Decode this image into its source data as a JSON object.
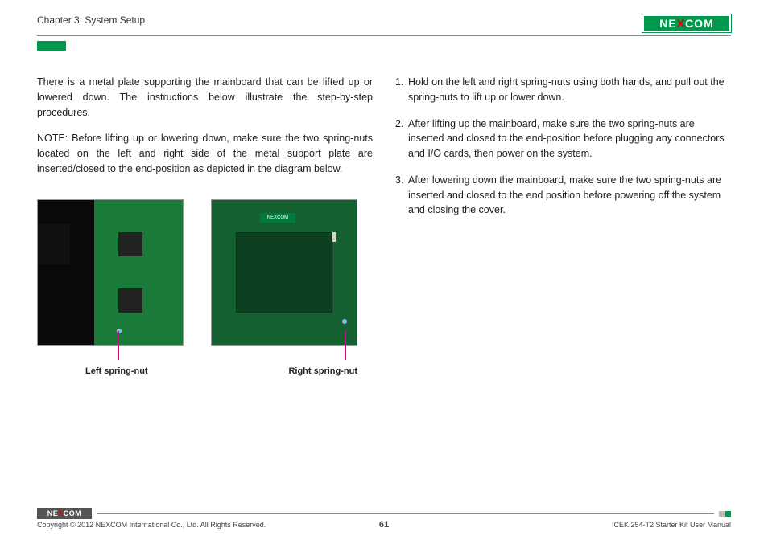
{
  "header": {
    "chapter": "Chapter 3: System Setup",
    "logo_text_pre": "NE",
    "logo_text_x": "X",
    "logo_text_post": "COM"
  },
  "left_column": {
    "para1": "There is a metal plate supporting the mainboard that can be lifted up or lowered down. The instructions below illustrate the step-by-step procedures.",
    "para2": "NOTE: Before lifting up or lowering down, make sure the two spring-nuts located on the left and right side of the metal support plate are inserted/closed to the end-position as depicted in the diagram below.",
    "label_left": "Left spring-nut",
    "label_right": "Right spring-nut"
  },
  "right_column": {
    "steps": [
      {
        "num": "1.",
        "text": "Hold on the left and right spring-nuts using both hands, and pull out the spring-nuts to lift up or lower down."
      },
      {
        "num": "2.",
        "text": "After lifting up the mainboard, make sure the two spring-nuts are inserted and closed to the end-position before plugging any connectors and I/O cards, then power on the system."
      },
      {
        "num": "3.",
        "text": "After lowering down the mainboard, make sure the two spring-nuts are inserted and closed to the end position before powering off the system and closing the cover."
      }
    ]
  },
  "footer": {
    "copyright": "Copyright © 2012 NEXCOM International Co., Ltd. All Rights Reserved.",
    "page": "61",
    "doc_title": "ICEK 254-T2 Starter Kit User Manual"
  }
}
